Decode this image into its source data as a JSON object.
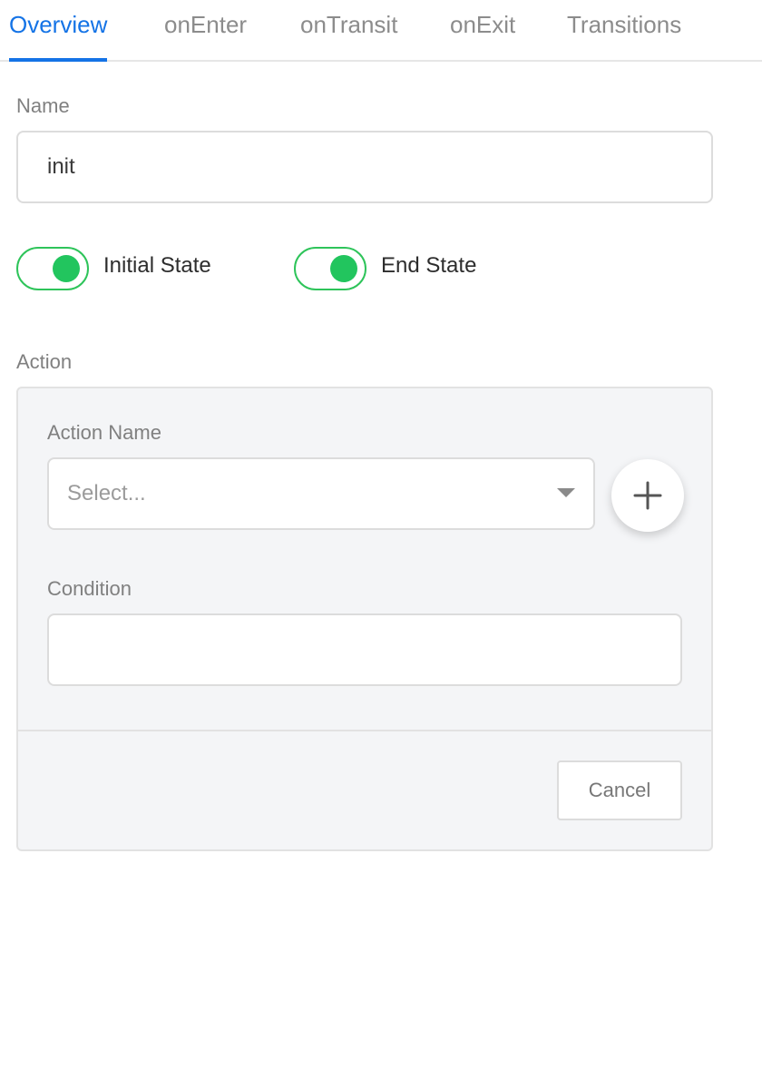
{
  "tabs": [
    {
      "label": "Overview",
      "active": true
    },
    {
      "label": "onEnter",
      "active": false
    },
    {
      "label": "onTransit",
      "active": false
    },
    {
      "label": "onExit",
      "active": false
    },
    {
      "label": "Transitions",
      "active": false
    }
  ],
  "name": {
    "label": "Name",
    "value": "init"
  },
  "toggles": {
    "initial_state": {
      "label": "Initial State",
      "on": true
    },
    "end_state": {
      "label": "End State",
      "on": true
    }
  },
  "action": {
    "section_label": "Action",
    "action_name_label": "Action Name",
    "action_name_placeholder": "Select...",
    "add_icon": "plus-icon",
    "condition_label": "Condition",
    "condition_value": "",
    "cancel_label": "Cancel"
  },
  "colors": {
    "accent": "#1473e6",
    "toggle_on": "#22c55e"
  }
}
